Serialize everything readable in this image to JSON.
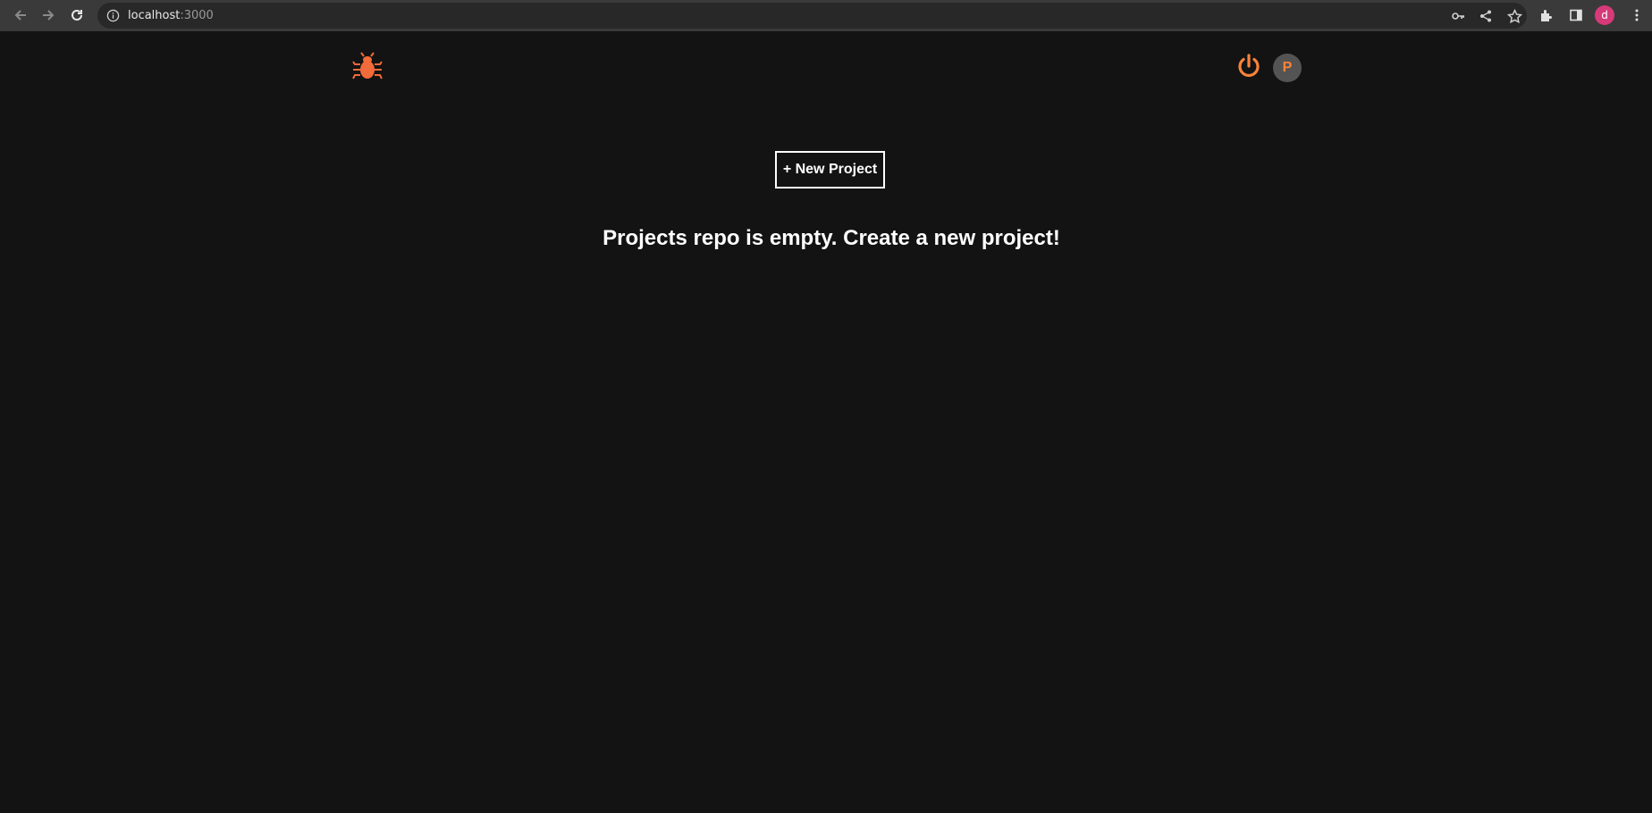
{
  "browser": {
    "url_host": "localhost",
    "url_port": ":3000",
    "profile_initial": "d",
    "icons": [
      "back-icon",
      "forward-icon",
      "reload-icon",
      "info-icon",
      "key-icon",
      "share-icon",
      "star-icon",
      "extensions-icon",
      "side-panel-icon",
      "menu-icon"
    ]
  },
  "app": {
    "logo_icon": "bug-icon",
    "user_initial": "P",
    "new_project_label": "+ New Project",
    "empty_message": "Projects repo is empty. Create a new project!",
    "colors": {
      "background": "#131313",
      "accent": "#f7833a",
      "logo": "#f26b3a",
      "avatar_bg": "#545454"
    }
  }
}
